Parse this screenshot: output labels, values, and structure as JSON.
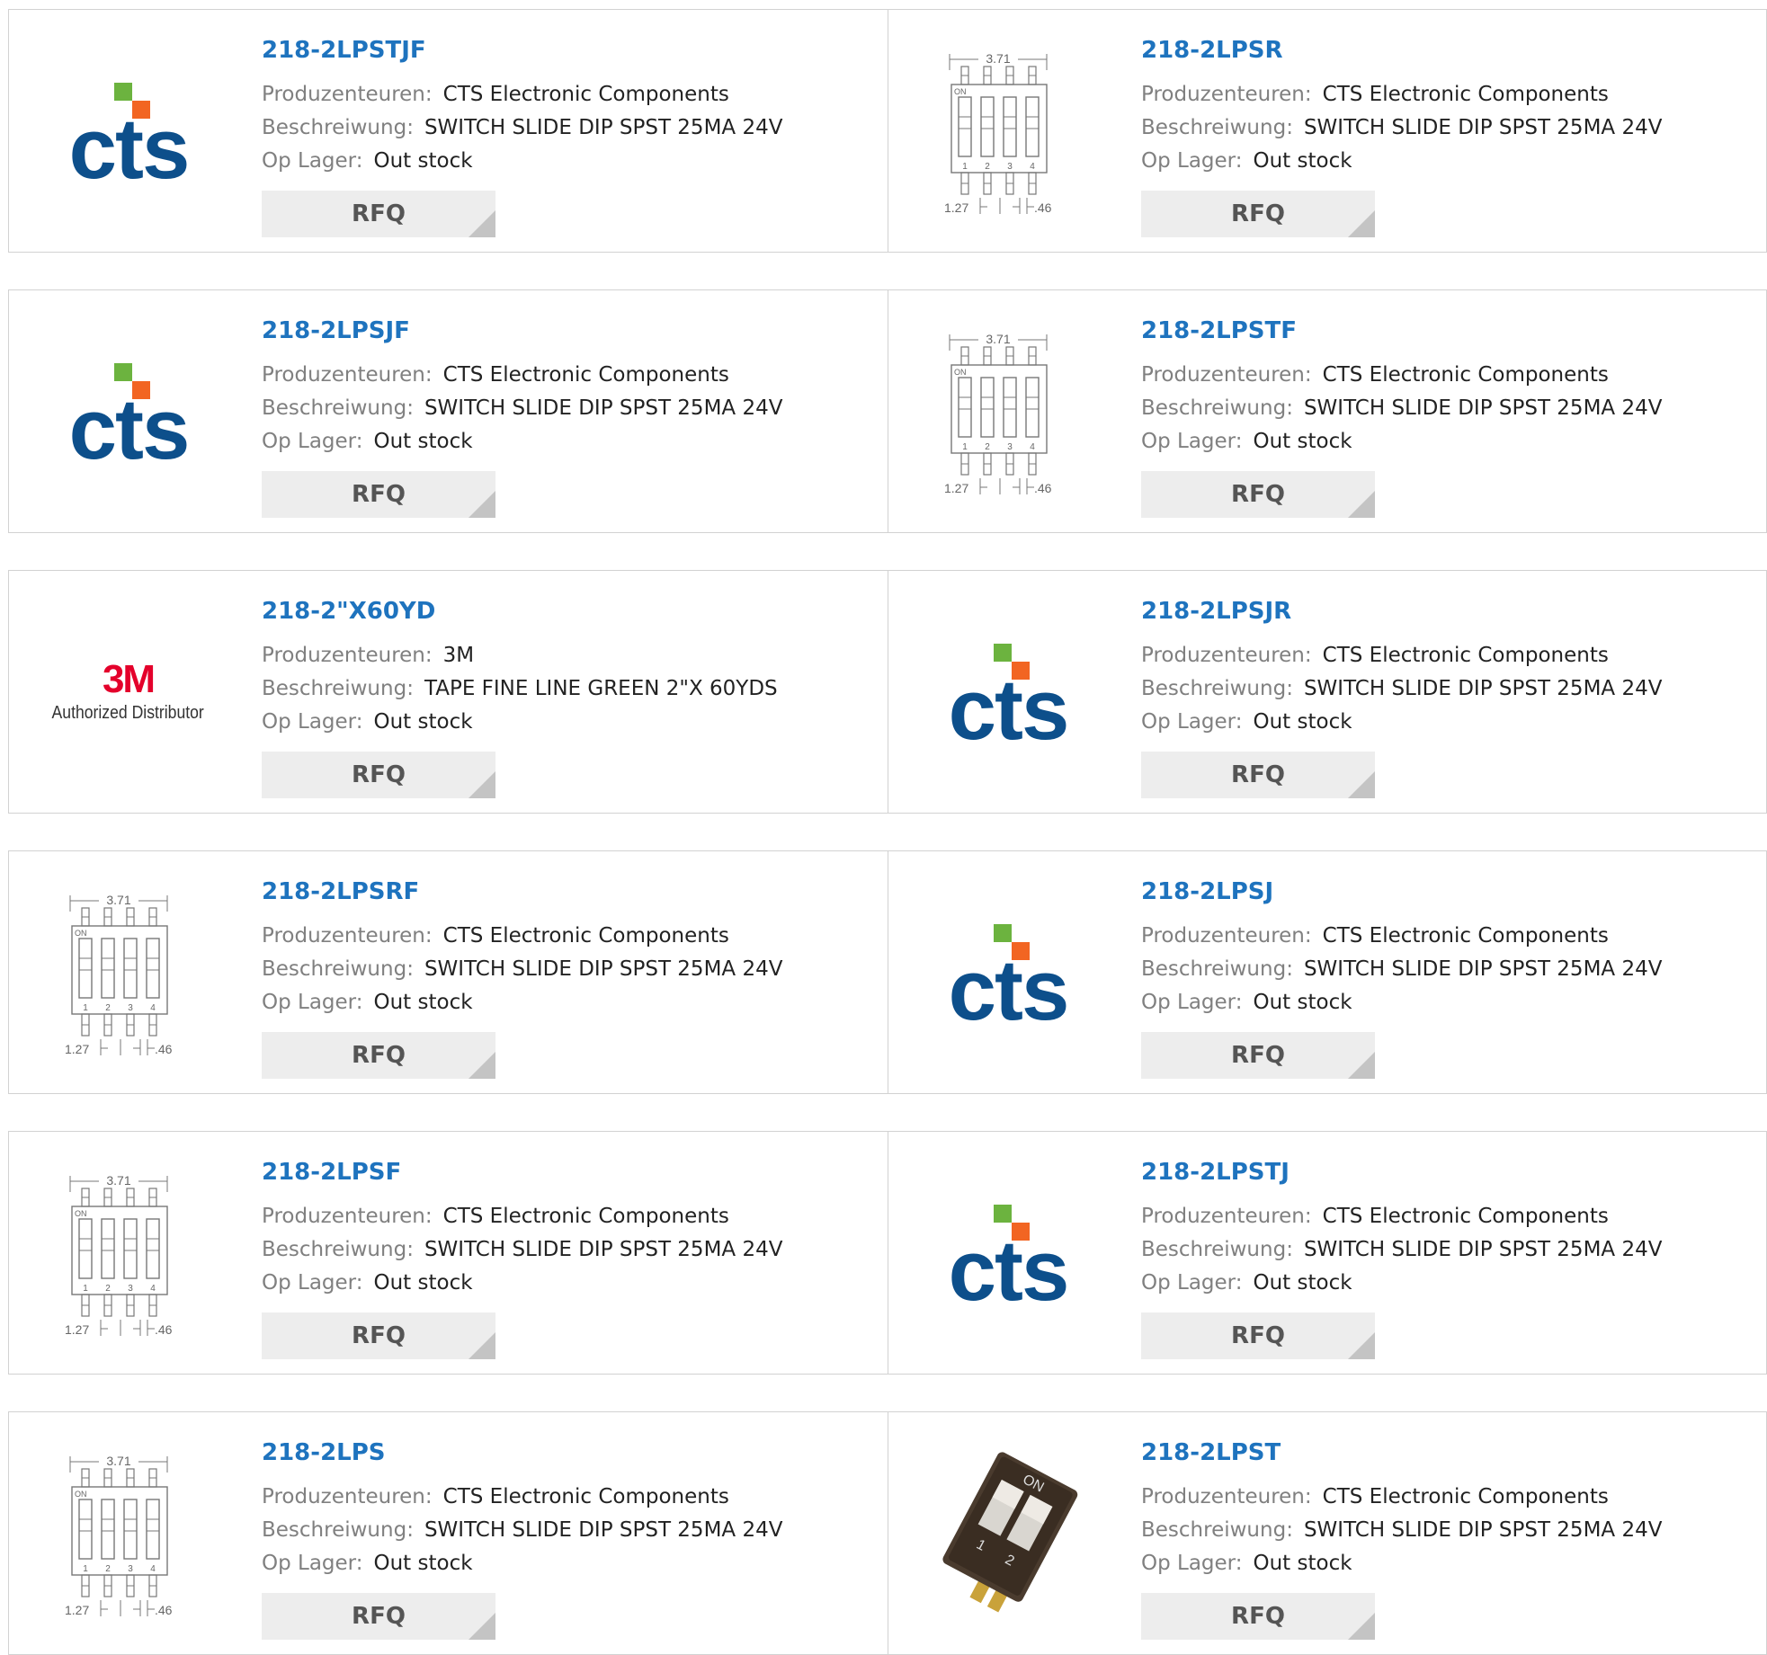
{
  "labels": {
    "manufacturer": "Produzenteuren:",
    "description": "Beschreiwung:",
    "stock": "Op Lager:",
    "rfq": "RFQ"
  },
  "logos": {
    "cts_text": "cts",
    "m3_text": "3M",
    "m3_sub": "Authorized Distributor",
    "diagram_width": "3.71",
    "diagram_on": "ON",
    "diagram_pitch": "1.27",
    "diagram_pin": ".46",
    "diagram_pins": [
      "1",
      "2",
      "3",
      "4"
    ],
    "switch_on": "ON",
    "switch_pins": [
      "1",
      "2"
    ]
  },
  "colors": {
    "link": "#1e73be",
    "cts_blue": "#0d4f8b",
    "cts_green": "#6cb33f",
    "cts_orange": "#f26522",
    "m3_red": "#e4002b"
  },
  "products": [
    {
      "pn": "218-2LPSTJF",
      "manufacturer": "CTS Electronic Components",
      "description": "SWITCH SLIDE DIP SPST 25MA 24V",
      "stock": "Out stock",
      "image": "cts-logo"
    },
    {
      "pn": "218-2LPSR",
      "manufacturer": "CTS Electronic Components",
      "description": "SWITCH SLIDE DIP SPST 25MA 24V",
      "stock": "Out stock",
      "image": "dip-diagram"
    },
    {
      "pn": "218-2LPSJF",
      "manufacturer": "CTS Electronic Components",
      "description": "SWITCH SLIDE DIP SPST 25MA 24V",
      "stock": "Out stock",
      "image": "cts-logo"
    },
    {
      "pn": "218-2LPSTF",
      "manufacturer": "CTS Electronic Components",
      "description": "SWITCH SLIDE DIP SPST 25MA 24V",
      "stock": "Out stock",
      "image": "dip-diagram"
    },
    {
      "pn": "218-2\"X60YD",
      "manufacturer": "3M",
      "description": "TAPE FINE LINE GREEN 2\"X 60YDS",
      "stock": "Out stock",
      "image": "3m-logo"
    },
    {
      "pn": "218-2LPSJR",
      "manufacturer": "CTS Electronic Components",
      "description": "SWITCH SLIDE DIP SPST 25MA 24V",
      "stock": "Out stock",
      "image": "cts-logo"
    },
    {
      "pn": "218-2LPSRF",
      "manufacturer": "CTS Electronic Components",
      "description": "SWITCH SLIDE DIP SPST 25MA 24V",
      "stock": "Out stock",
      "image": "dip-diagram"
    },
    {
      "pn": "218-2LPSJ",
      "manufacturer": "CTS Electronic Components",
      "description": "SWITCH SLIDE DIP SPST 25MA 24V",
      "stock": "Out stock",
      "image": "cts-logo"
    },
    {
      "pn": "218-2LPSF",
      "manufacturer": "CTS Electronic Components",
      "description": "SWITCH SLIDE DIP SPST 25MA 24V",
      "stock": "Out stock",
      "image": "dip-diagram"
    },
    {
      "pn": "218-2LPSTJ",
      "manufacturer": "CTS Electronic Components",
      "description": "SWITCH SLIDE DIP SPST 25MA 24V",
      "stock": "Out stock",
      "image": "cts-logo"
    },
    {
      "pn": "218-2LPS",
      "manufacturer": "CTS Electronic Components",
      "description": "SWITCH SLIDE DIP SPST 25MA 24V",
      "stock": "Out stock",
      "image": "dip-diagram"
    },
    {
      "pn": "218-2LPST",
      "manufacturer": "CTS Electronic Components",
      "description": "SWITCH SLIDE DIP SPST 25MA 24V",
      "stock": "Out stock",
      "image": "switch-photo"
    }
  ]
}
